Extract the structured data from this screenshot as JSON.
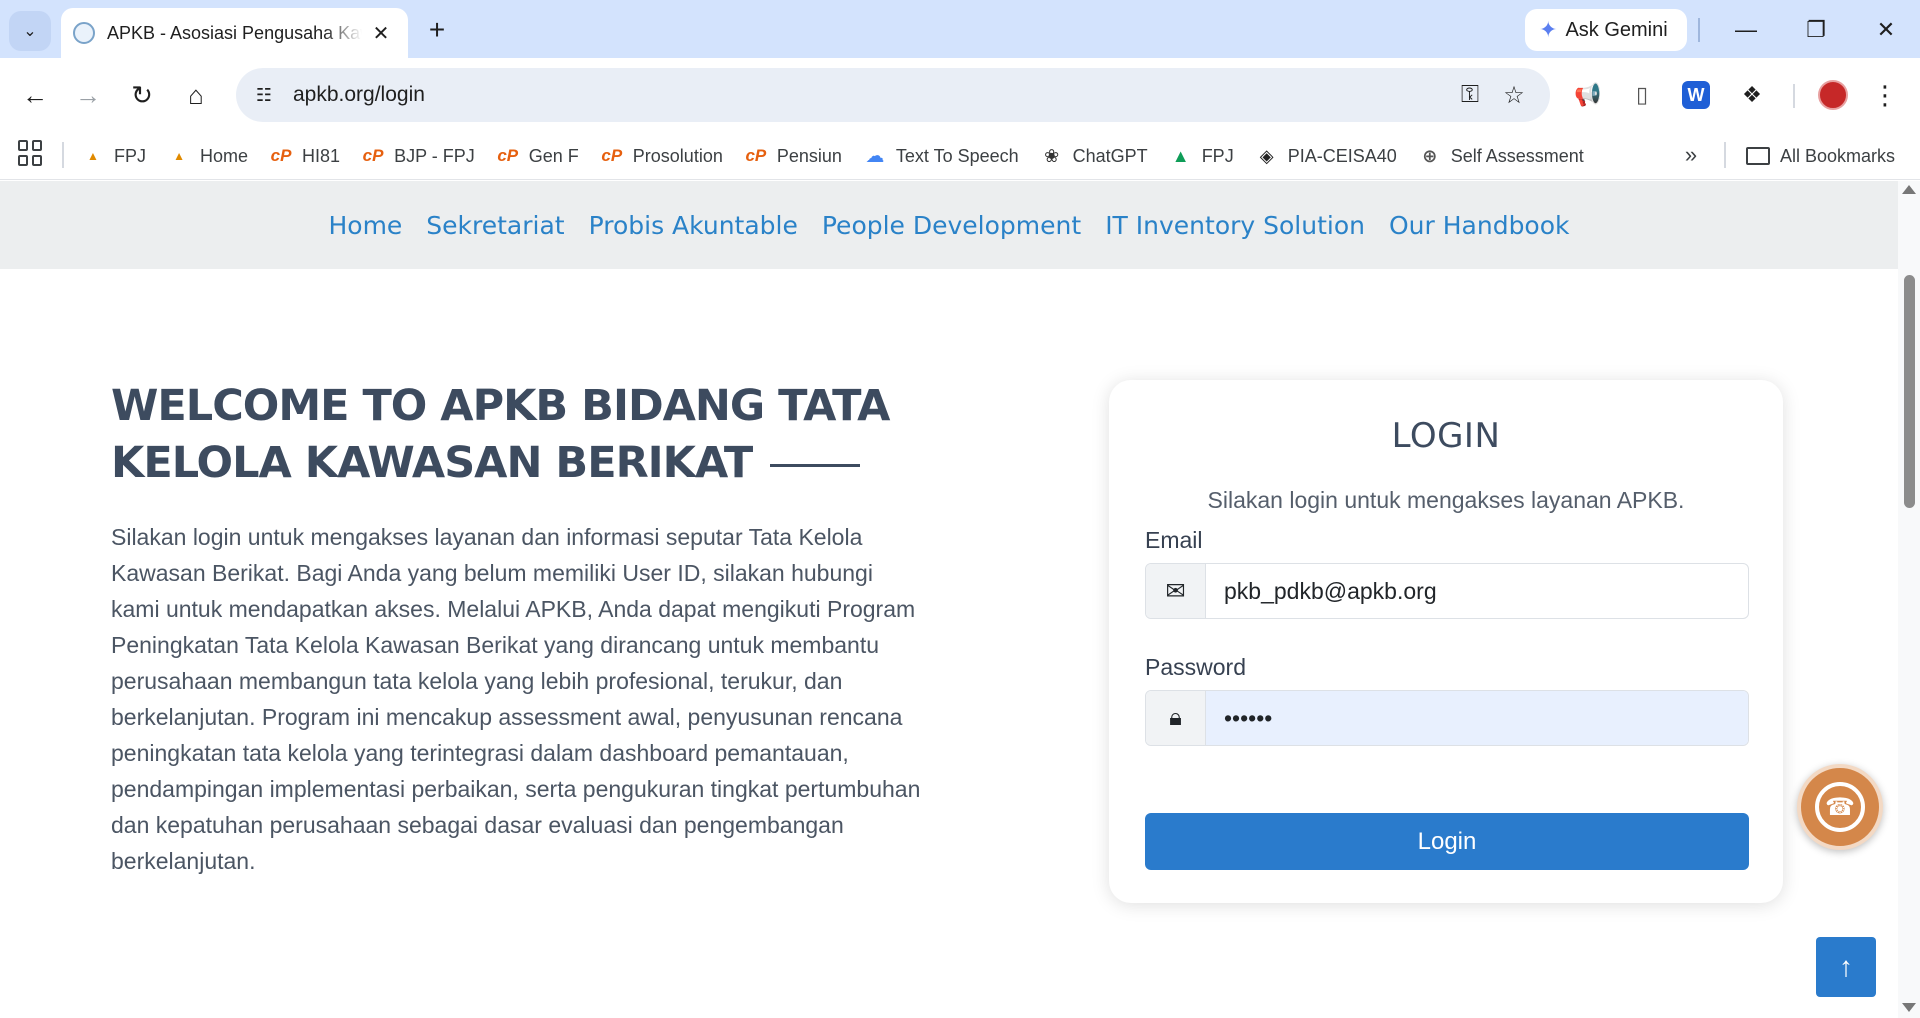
{
  "browser": {
    "tab_title": "APKB - Asosiasi Pengusaha Kawasan Berikat",
    "new_tab_label": "+",
    "ask_gemini_label": "Ask Gemini",
    "url": "apkb.org/login",
    "bookmarks": [
      {
        "label": "FPJ",
        "icon": "pma-logo-icon"
      },
      {
        "label": "Home",
        "icon": "pma-logo-icon"
      },
      {
        "label": "HI81",
        "icon": "cp-logo-icon"
      },
      {
        "label": "BJP - FPJ",
        "icon": "cp-logo-icon"
      },
      {
        "label": "Gen F",
        "icon": "cp-logo-icon"
      },
      {
        "label": "Prosolution",
        "icon": "cp-logo-icon"
      },
      {
        "label": "Pensiun",
        "icon": "cp-logo-icon"
      },
      {
        "label": "Text To Speech",
        "icon": "cloud-icon"
      },
      {
        "label": "ChatGPT",
        "icon": "chatgpt-icon"
      },
      {
        "label": "FPJ",
        "icon": "drive-icon"
      },
      {
        "label": "PIA-CEISA40",
        "icon": "layers-icon"
      },
      {
        "label": "Self Assessment",
        "icon": "globe-icon"
      }
    ],
    "all_bookmarks_label": "All Bookmarks"
  },
  "site_nav": {
    "items": [
      "Home",
      "Sekretariat",
      "Probis Akuntable",
      "People Development",
      "IT Inventory Solution",
      "Our Handbook"
    ],
    "color": "#2a82c8"
  },
  "welcome": {
    "title": "WELCOME TO APKB BIDANG TATA KELOLA KAWASAN BERIKAT",
    "text": "Silakan login untuk mengakses layanan dan informasi seputar Tata Kelola Kawasan Berikat. Bagi Anda yang belum memiliki User ID, silakan hubungi kami untuk mendapatkan akses. Melalui APKB, Anda dapat mengikuti Program Peningkatan Tata Kelola Kawasan Berikat yang dirancang untuk membantu perusahaan membangun tata kelola yang lebih profesional, terukur, dan berkelanjutan. Program ini mencakup assessment awal, penyusunan rencana peningkatan tata kelola yang terintegrasi dalam dashboard pemantauan, pendampingan implementasi perbaikan, serta pengukuran tingkat pertumbuhan dan kepatuhan perusahaan sebagai dasar evaluasi dan pengembangan berkelanjutan."
  },
  "login": {
    "title": "LOGIN",
    "subtitle": "Silakan login untuk mengakses layanan APKB.",
    "email_label": "Email",
    "email_value": "pkb_pdkb@apkb.org",
    "password_label": "Password",
    "password_value": "••••••",
    "button_label": "Login",
    "button_color": "#2a7bcc"
  },
  "floating": {
    "whatsapp_icon": "whatsapp-icon",
    "back_to_top_icon": "arrow-up-icon"
  }
}
